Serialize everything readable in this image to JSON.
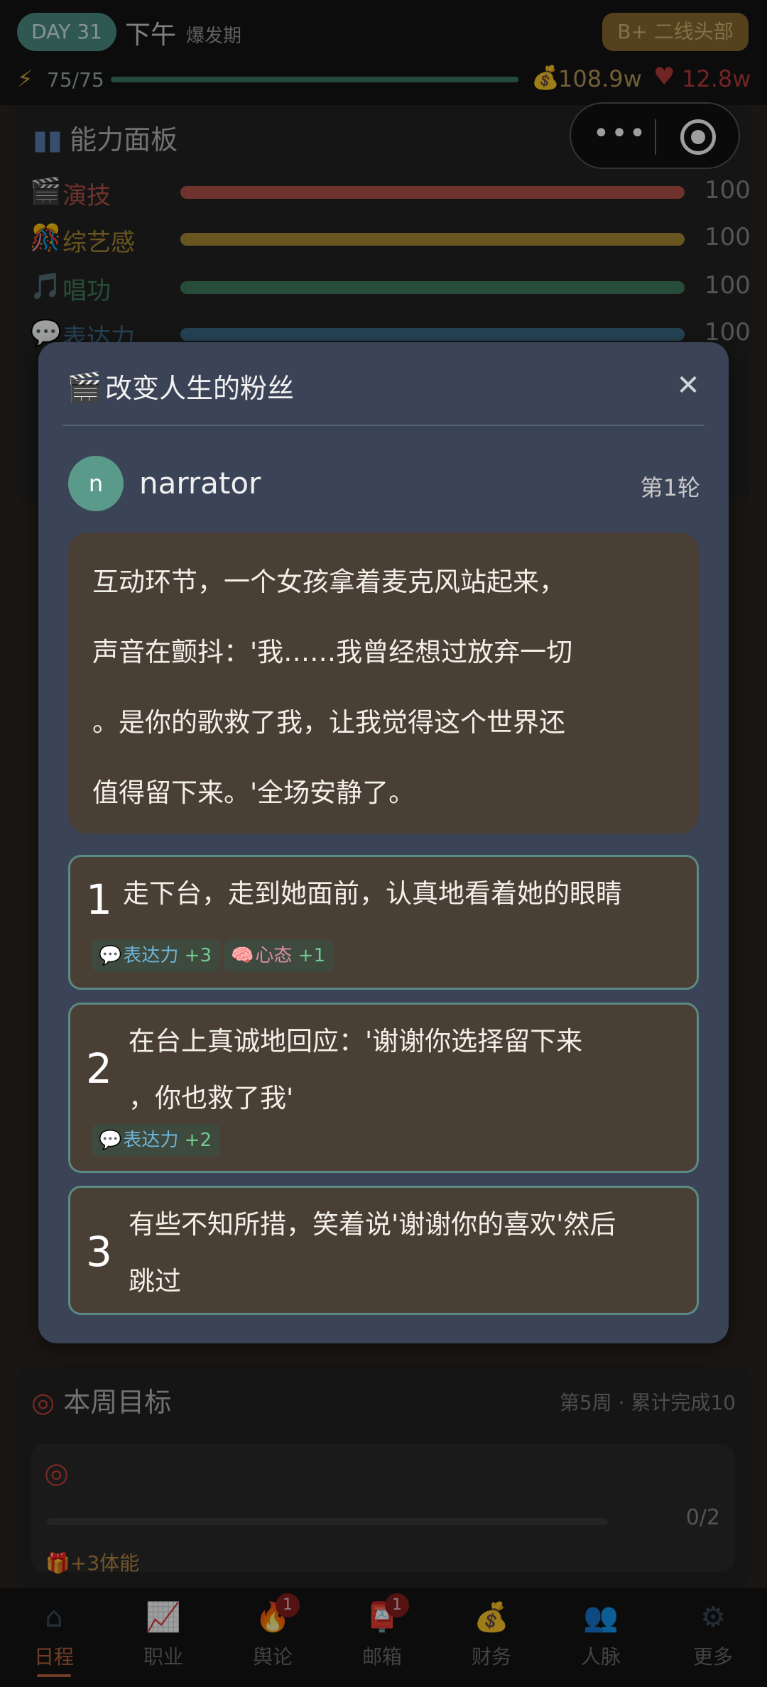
{
  "topbar": {
    "day_badge": "DAY 31",
    "time_of_day": "下午",
    "phase": "爆发期",
    "rank": "B+ 二线头部",
    "energy": "75/75",
    "energy_fraction": 1.0,
    "money": "108.9w",
    "fans": "12.8w"
  },
  "ability_panel": {
    "title": "能力面板",
    "stats": [
      {
        "label": "演技",
        "value": "100",
        "color": "#b3524a",
        "label_color": "#b3524a",
        "icon": "🎬"
      },
      {
        "label": "综艺感",
        "value": "100",
        "color": "#a88a33",
        "label_color": "#a88a33",
        "icon": "🎊"
      },
      {
        "label": "唱功",
        "value": "100",
        "color": "#3f7d5e",
        "label_color": "#3f7d5e",
        "icon": "🎵"
      },
      {
        "label": "表达力",
        "value": "100",
        "color": "#3c6b86",
        "label_color": "#3c6b86",
        "icon": "💬"
      }
    ]
  },
  "modal": {
    "title": "改变人生的粉丝",
    "speaker": {
      "initial": "n",
      "name": "narrator",
      "round": "第1轮"
    },
    "narrative": "互动环节，一个女孩拿着麦克风站起来，\n声音在颤抖：'我……我曾经想过放弃一切\n。是你的歌救了我，让我觉得这个世界还\n值得留下来。'全场安静了。",
    "choices": [
      {
        "number": "1",
        "text_line1": "走下台，走到她面前，认真地看着她的眼睛",
        "text_line2": "",
        "tags": [
          {
            "name": "表达力",
            "delta": "+3"
          },
          {
            "name": "心态",
            "delta": "+1"
          }
        ]
      },
      {
        "number": "2",
        "text_line1": "在台上真诚地回应：'谢谢你选择留下来",
        "text_line2": "，你也救了我'",
        "tags": [
          {
            "name": "表达力",
            "delta": "+2"
          }
        ]
      },
      {
        "number": "3",
        "text_line1": "有些不知所措，笑着说'谢谢你的喜欢'然后",
        "text_line2": "跳过",
        "tags": []
      }
    ]
  },
  "weekly_goals": {
    "title": "本周目标",
    "meta": "第5周 · 累计完成10",
    "progress": "0/2",
    "progress_fraction": 0,
    "reward": "+3体能"
  },
  "tabbar": {
    "tabs": [
      {
        "label": "日程",
        "icon": "house-icon",
        "badge": ""
      },
      {
        "label": "职业",
        "icon": "chart-icon",
        "badge": ""
      },
      {
        "label": "舆论",
        "icon": "fire-icon",
        "badge": "1"
      },
      {
        "label": "邮箱",
        "icon": "mailbox-icon",
        "badge": "1"
      },
      {
        "label": "财务",
        "icon": "money-bag-icon",
        "badge": ""
      },
      {
        "label": "人脉",
        "icon": "people-icon",
        "badge": ""
      },
      {
        "label": "更多",
        "icon": "gear-icon",
        "badge": ""
      }
    ]
  }
}
